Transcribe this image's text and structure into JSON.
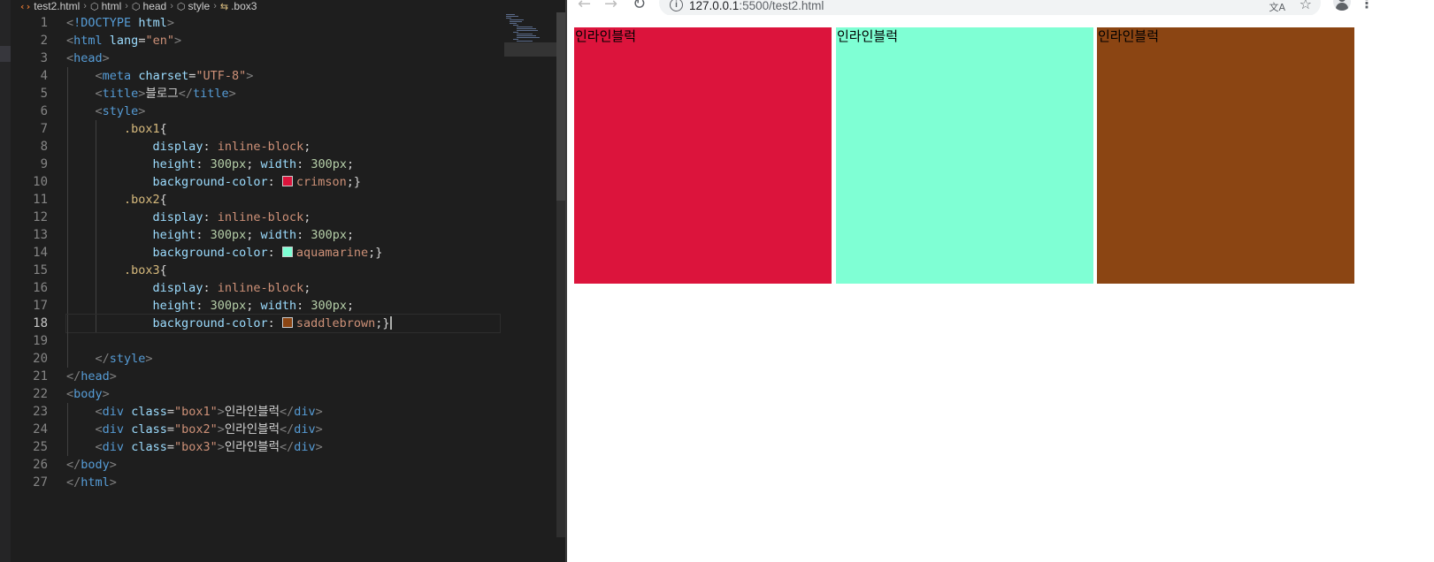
{
  "breadcrumb": [
    {
      "label": "test2.html",
      "icon": "html-file-icon"
    },
    {
      "label": "html",
      "icon": "element-icon"
    },
    {
      "label": "head",
      "icon": "element-icon"
    },
    {
      "label": "style",
      "icon": "element-icon"
    },
    {
      "label": ".box3",
      "icon": "selector-icon"
    }
  ],
  "editor": {
    "active_line": 18,
    "line_numbers": [
      "1",
      "2",
      "3",
      "4",
      "5",
      "6",
      "7",
      "8",
      "9",
      "10",
      "11",
      "12",
      "13",
      "14",
      "15",
      "16",
      "17",
      "18",
      "19",
      "20",
      "21",
      "22",
      "23",
      "24",
      "25",
      "26",
      "27"
    ],
    "lines": [
      "<!DOCTYPE html>",
      "<html lang=\"en\">",
      "<head>",
      "<meta charset=\"UTF-8\">",
      "<title>블로그</title>",
      "<style>",
      ".box1{",
      "display: inline-block;",
      "height: 300px; width: 300px;",
      "background-color: crimson;}",
      ".box2{",
      "display: inline-block;",
      "height: 300px; width: 300px;",
      "background-color: aquamarine;}",
      ".box3{",
      "display: inline-block;",
      "height: 300px; width: 300px;",
      "background-color: saddlebrown;}",
      "",
      "</style>",
      "</head>",
      "<body>",
      "<div class=\"box1\">인라인블럭</div>",
      "<div class=\"box2\">인라인블럭</div>",
      "<div class=\"box3\">인라인블럭</div>",
      "</body>",
      "</html>"
    ]
  },
  "browser": {
    "url_host": "127.0.0.1",
    "url_rest": ":5500/test2.html",
    "back_icon": "←",
    "forward_icon": "→",
    "reload_icon": "↻",
    "star_icon": "☆",
    "menu_icon": "⋮"
  },
  "page": {
    "boxes": [
      {
        "text": "인라인블럭",
        "color": "#dc143c"
      },
      {
        "text": "인라인블럭",
        "color": "#7fffd4"
      },
      {
        "text": "인라인블럭",
        "color": "#8b4513"
      }
    ]
  }
}
